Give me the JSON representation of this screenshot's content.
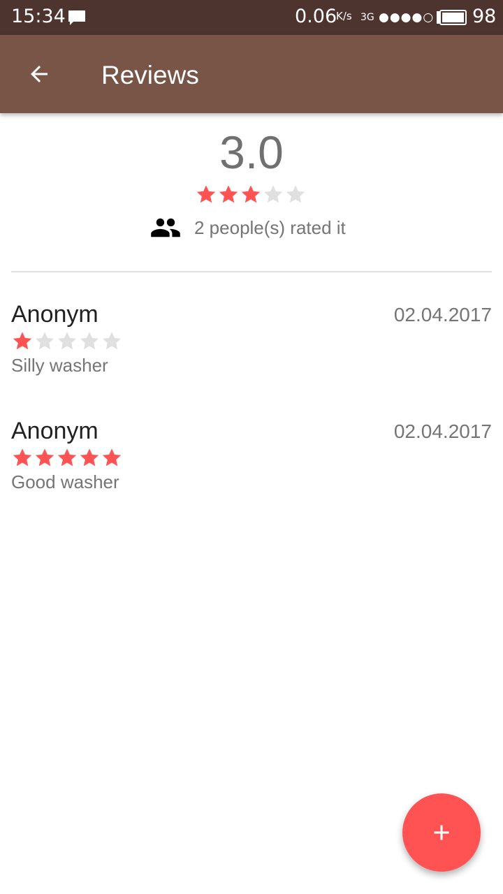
{
  "status_bar": {
    "time": "15:34",
    "net_speed": "0.06",
    "net_unit": "K/s",
    "net_type": "3G",
    "signal": "●●●●○",
    "battery": "98",
    "icons": [
      "message-icon",
      "battery-icon"
    ]
  },
  "app_bar": {
    "title": "Reviews",
    "back_icon": "arrow-back-icon",
    "color": "#795548"
  },
  "summary": {
    "average": "3.0",
    "average_stars": 3,
    "max_stars": 5,
    "rated_text": "2 people(s) rated it",
    "people_icon": "people-icon"
  },
  "reviews": [
    {
      "author": "Anonym",
      "date": "02.04.2017",
      "stars": 1,
      "text": "Silly washer"
    },
    {
      "author": "Anonym",
      "date": "02.04.2017",
      "stars": 5,
      "text": "Good washer"
    }
  ],
  "fab": {
    "icon": "plus-icon",
    "color": "#ff5252"
  },
  "colors": {
    "status_bar": "#4e342e",
    "star_filled": "#ff5252",
    "star_empty": "#e0e0e0"
  }
}
